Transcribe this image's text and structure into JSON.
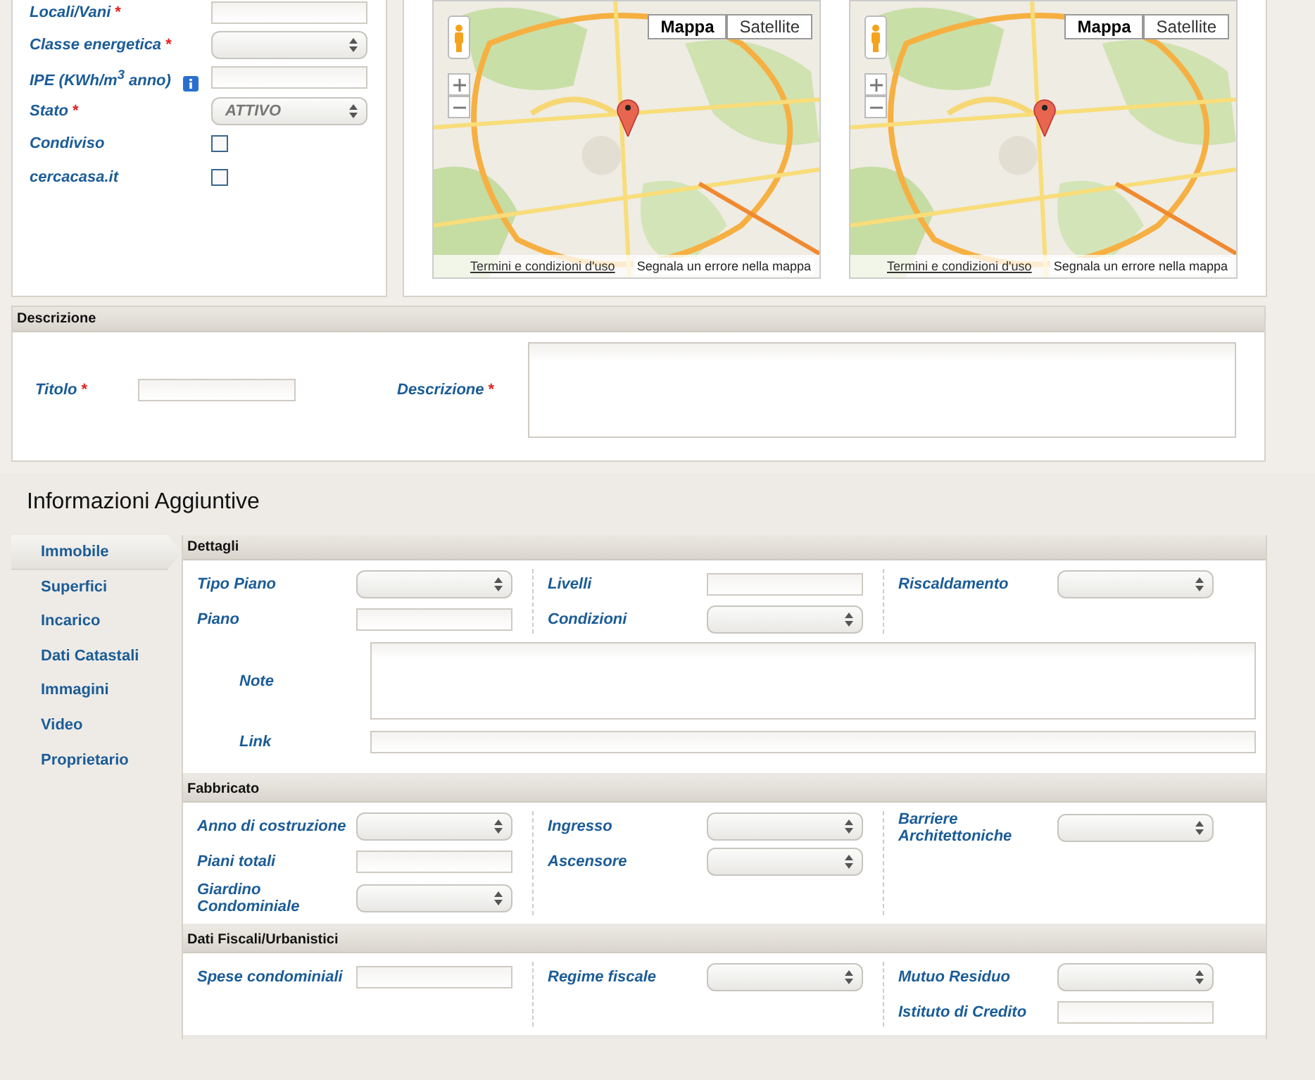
{
  "property_form": {
    "fields": [
      {
        "label": "Locali/Vani",
        "required_mark": "*",
        "kind": "text"
      },
      {
        "label": "Classe energetica",
        "required_mark": "*",
        "kind": "select"
      },
      {
        "label": "IPE (KWh/m$^{3}$ anno)",
        "kind": "text",
        "info": true
      },
      {
        "label": "Stato",
        "required_mark": "*",
        "kind": "select",
        "value": "ATTIVO"
      },
      {
        "label": "Condiviso",
        "kind": "checkbox",
        "checked": false
      },
      {
        "label": "cercacasa.it",
        "kind": "checkbox",
        "checked": false
      }
    ]
  },
  "maps": [
    {
      "map_types": [
        {
          "label": "Mappa",
          "selected": true
        },
        {
          "label": "Satellite",
          "selected": false
        }
      ],
      "terms_link": "Termini e condizioni d'uso",
      "report_link": "Segnala un errore nella mappa"
    },
    {
      "map_types": [
        {
          "label": "Mappa",
          "selected": true
        },
        {
          "label": "Satellite",
          "selected": false
        }
      ],
      "terms_link": "Termini e condizioni d'uso",
      "report_link": "Segnala un errore nella mappa"
    }
  ],
  "description_panel": {
    "title": "Descrizione",
    "fields": [
      {
        "label": "Titolo",
        "required_mark": "*",
        "kind": "text"
      },
      {
        "label": "Descrizione",
        "required_mark": "*",
        "kind": "textarea"
      }
    ]
  },
  "additional_info": {
    "title": "Informazioni Aggiuntive",
    "tabs": [
      {
        "label": "Immobile",
        "selected": true
      },
      {
        "label": "Superfici",
        "selected": false
      },
      {
        "label": "Incarico",
        "selected": false
      },
      {
        "label": "Dati Catastali",
        "selected": false
      },
      {
        "label": "Immagini",
        "selected": false
      },
      {
        "label": "Video",
        "selected": false
      },
      {
        "label": "Proprietario",
        "selected": false
      }
    ],
    "sections": [
      {
        "title": "Dettagli",
        "columns": [
          [
            {
              "label": "Tipo Piano",
              "kind": "select"
            },
            {
              "label": "Piano",
              "kind": "text"
            }
          ],
          [
            {
              "label": "Livelli",
              "kind": "text"
            },
            {
              "label": "Condizioni",
              "kind": "select"
            }
          ],
          [
            {
              "label": "Riscaldamento",
              "kind": "select"
            }
          ]
        ],
        "wide_fields": [
          {
            "label": "Note",
            "kind": "textarea"
          },
          {
            "label": "Link",
            "kind": "text"
          }
        ]
      },
      {
        "title": "Fabbricato",
        "columns": [
          [
            {
              "label": "Anno di costruzione",
              "kind": "select"
            },
            {
              "label": "Piani totali",
              "kind": "text"
            },
            {
              "label": "Giardino Condominiale",
              "kind": "select"
            }
          ],
          [
            {
              "label": "Ingresso",
              "kind": "select"
            },
            {
              "label": "Ascensore",
              "kind": "select"
            }
          ],
          [
            {
              "label": "Barriere Architettoniche",
              "kind": "select"
            }
          ]
        ]
      },
      {
        "title": "Dati Fiscali/Urbanistici",
        "columns": [
          [
            {
              "label": "Spese condominiali",
              "kind": "text"
            }
          ],
          [
            {
              "label": "Regime fiscale",
              "kind": "select"
            }
          ],
          [
            {
              "label": "Mutuo Residuo",
              "kind": "select"
            },
            {
              "label": "Istituto di Credito",
              "kind": "text"
            }
          ]
        ]
      }
    ]
  }
}
